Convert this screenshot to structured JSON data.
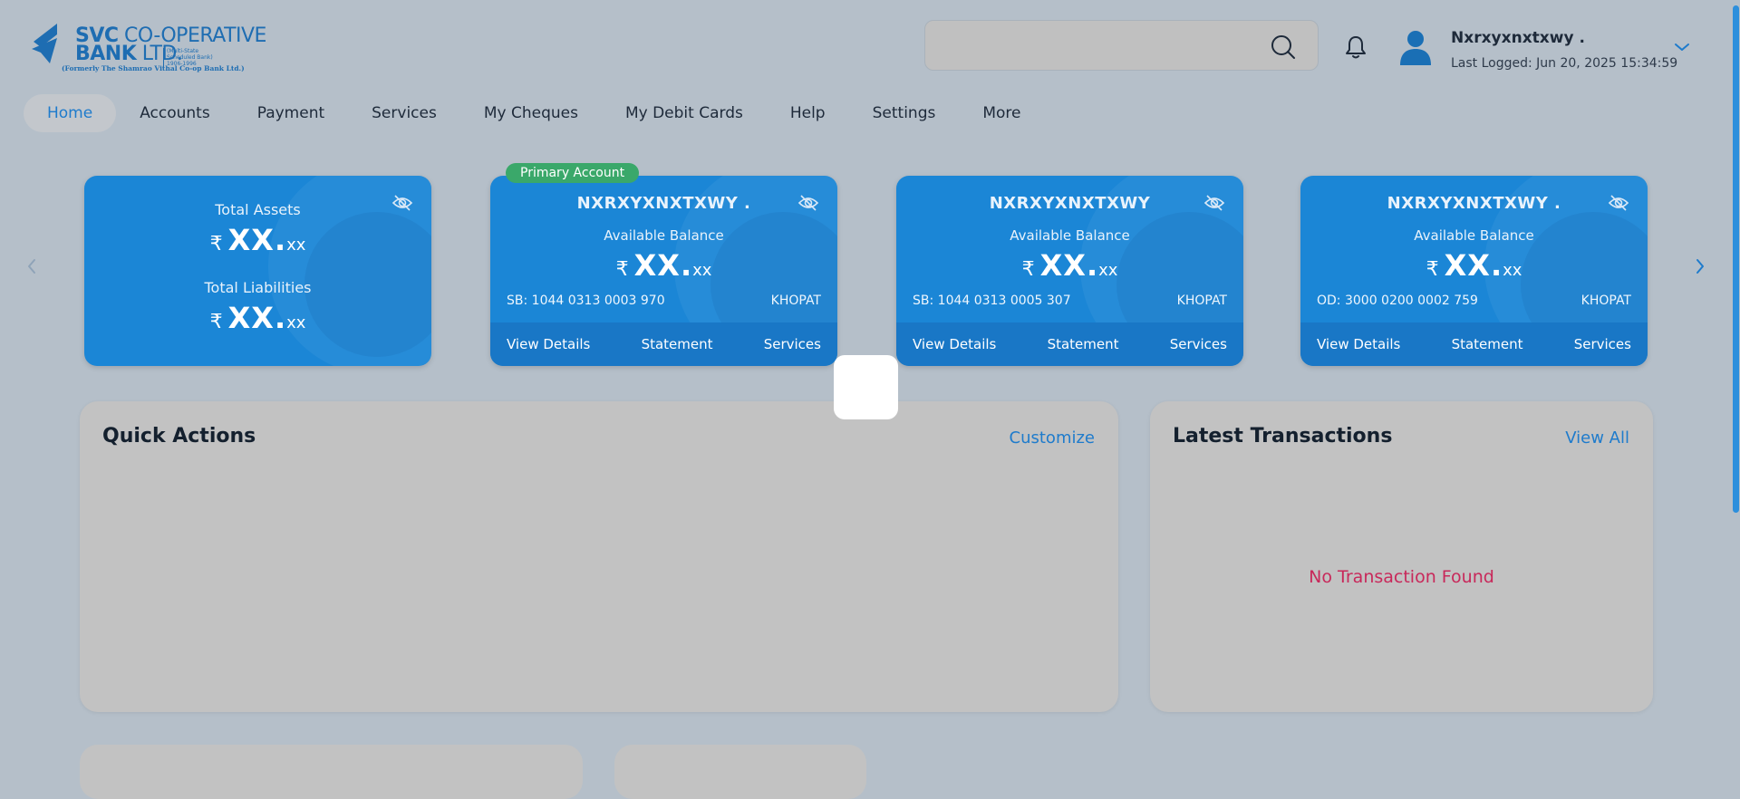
{
  "logo": {
    "line1_bold": "SVC",
    "line1_rest": " CO-OPERATIVE",
    "line2_bold": "BANK",
    "line2_rest": " LTD.",
    "tagline": "(Multi-State Scheduled Bank) 1906-1996",
    "formerly": "(Formerly The Shamrao Vithal Co-op Bank Ltd.)",
    "brand_color": "#1e6db2"
  },
  "header": {
    "search_placeholder": "",
    "user_name": "Nxrxyxnxtxwy .",
    "last_logged": "Last Logged: Jun 20, 2025 15:34:59"
  },
  "nav": {
    "items": [
      "Home",
      "Accounts",
      "Payment",
      "Services",
      "My Cheques",
      "My Debit Cards",
      "Help",
      "Settings",
      "More"
    ],
    "active": "Home"
  },
  "cards": {
    "summary": {
      "assets_label": "Total Assets",
      "liabilities_label": "Total Liabilities",
      "currency": "₹",
      "amount_big": "XX.",
      "amount_small": "xx"
    },
    "primary_badge": "Primary Account",
    "accounts": [
      {
        "name": "NXRXYXNXTXWY .",
        "balance_label": "Available Balance",
        "currency": "₹",
        "amount_big": "XX.",
        "amount_small": "xx",
        "account_no": "SB: 1044 0313 0003 970",
        "branch": "KHOPAT",
        "actions": [
          "View Details",
          "Statement",
          "Services"
        ]
      },
      {
        "name": "NXRXYXNXTXWY",
        "balance_label": "Available Balance",
        "currency": "₹",
        "amount_big": "XX.",
        "amount_small": "xx",
        "account_no": "SB: 1044 0313 0005 307",
        "branch": "KHOPAT",
        "actions": [
          "View Details",
          "Statement",
          "Services"
        ]
      },
      {
        "name": "NXRXYXNXTXWY .",
        "balance_label": "Available Balance",
        "currency": "₹",
        "amount_big": "XX.",
        "amount_small": "xx",
        "account_no": "OD: 3000 0200 0002 759",
        "branch": "KHOPAT",
        "actions": [
          "View Details",
          "Statement",
          "Services"
        ]
      }
    ]
  },
  "quick_actions": {
    "title": "Quick Actions",
    "link": "Customize"
  },
  "transactions": {
    "title": "Latest Transactions",
    "link": "View All",
    "empty_message": "No Transaction Found"
  },
  "colors": {
    "accent": "#1e7bcc",
    "card": "#1b86d6",
    "badge": "#3aa86a",
    "error": "#c8285a"
  }
}
